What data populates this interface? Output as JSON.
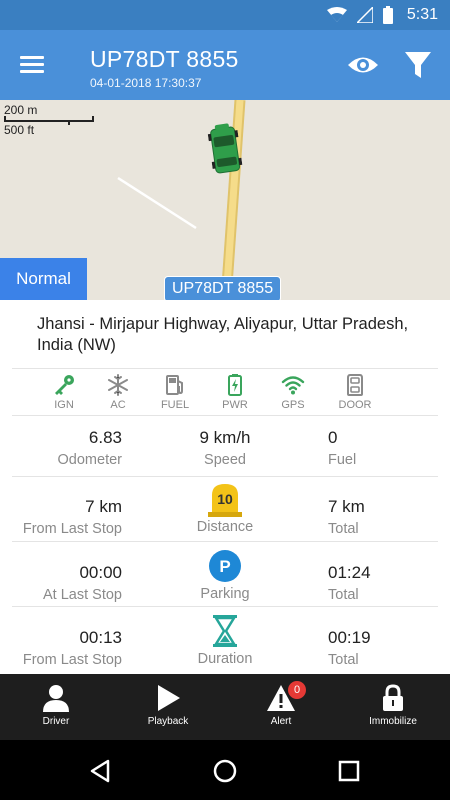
{
  "status_bar": {
    "time": "5:31"
  },
  "app_bar": {
    "title": "UP78DT 8855",
    "subtitle": "04-01-2018 17:30:37"
  },
  "map": {
    "scale_metric": "200 m",
    "scale_imperial": "500 ft",
    "vehicle_label": "UP78DT 8855",
    "mode_button": "Normal"
  },
  "address": "Jhansi - Mirjapur Highway,  Aliyapur, Uttar Pradesh,  India (NW)",
  "status_icons": [
    {
      "label": "IGN",
      "icon": "key-icon",
      "color": "#3aa55c"
    },
    {
      "label": "AC",
      "icon": "snowflake-icon",
      "color": "#8a8a8a"
    },
    {
      "label": "FUEL",
      "icon": "fuel-pump-icon",
      "color": "#8a8a8a"
    },
    {
      "label": "PWR",
      "icon": "battery-icon",
      "color": "#3aa55c"
    },
    {
      "label": "GPS",
      "icon": "wifi-signal-icon",
      "color": "#3aa55c"
    },
    {
      "label": "DOOR",
      "icon": "car-door-icon",
      "color": "#8a8a8a"
    }
  ],
  "metrics": {
    "row1": {
      "left": {
        "value": "6.83",
        "label": "Odometer"
      },
      "center": {
        "value": "9 km/h",
        "label": "Speed"
      },
      "right": {
        "value": "0",
        "label": "Fuel"
      }
    },
    "row2": {
      "left": {
        "value": "7 km",
        "label": "From Last Stop"
      },
      "center": {
        "label": "Distance",
        "icon": "milestone-icon",
        "icon_text": "10"
      },
      "right": {
        "value": "7 km",
        "label": "Total"
      }
    },
    "row3": {
      "left": {
        "value": "00:00",
        "label": "At Last Stop"
      },
      "center": {
        "label": "Parking",
        "icon": "parking-icon",
        "icon_text": "P"
      },
      "right": {
        "value": "01:24",
        "label": "Total"
      }
    },
    "row4": {
      "left": {
        "value": "00:13",
        "label": "From Last Stop"
      },
      "center": {
        "label": "Duration",
        "icon": "hourglass-icon"
      },
      "right": {
        "value": "00:19",
        "label": "Total"
      }
    }
  },
  "bottom_nav": [
    {
      "label": "Driver",
      "icon": "driver-icon"
    },
    {
      "label": "Playback",
      "icon": "play-icon"
    },
    {
      "label": "Alert",
      "icon": "alert-icon",
      "badge": "0"
    },
    {
      "label": "Immobilize",
      "icon": "lock-icon"
    }
  ],
  "colors": {
    "app_bar": "#4a90d9",
    "status_bar": "#3a7fc1",
    "mode_button": "#3b82e8",
    "active_green": "#3aa55c",
    "distance_yellow": "#f3c318",
    "parking_blue": "#1e88d6",
    "duration_teal": "#26a69a"
  }
}
